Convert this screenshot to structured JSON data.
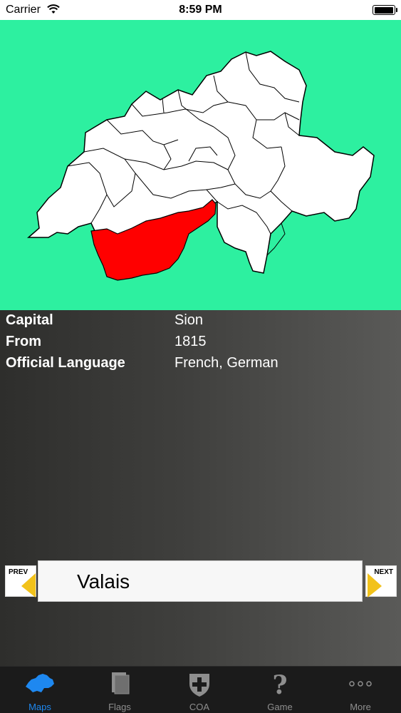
{
  "status_bar": {
    "carrier": "Carrier",
    "time": "8:59 PM",
    "battery_level": 1.0
  },
  "map": {
    "background_color": "#2df0a0",
    "highlight_color": "#ff0000",
    "region_fill": "#ffffff",
    "region_stroke": "#000000"
  },
  "info": {
    "rows": [
      {
        "label": "Capital",
        "value": "Sion"
      },
      {
        "label": "From",
        "value": "1815"
      },
      {
        "label": "Official Language",
        "value": "French, German"
      }
    ]
  },
  "nav": {
    "prev_label": "PREV",
    "next_label": "NEXT",
    "canton_name": "Valais",
    "arrow_color": "#f2c21a"
  },
  "tabs": [
    {
      "label": "Maps",
      "icon": "swiss-map-icon",
      "active": true
    },
    {
      "label": "Flags",
      "icon": "flags-book-icon",
      "active": false
    },
    {
      "label": "COA",
      "icon": "coat-of-arms-icon",
      "active": false
    },
    {
      "label": "Game",
      "icon": "question-mark-icon",
      "active": false
    },
    {
      "label": "More",
      "icon": "more-dots-icon",
      "active": false
    }
  ],
  "tab_active_color": "#1e88f0"
}
